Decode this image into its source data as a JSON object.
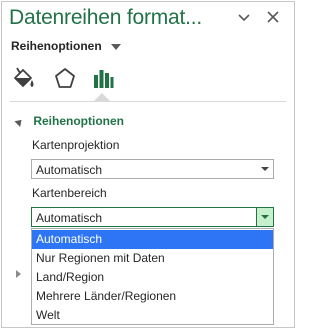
{
  "pane": {
    "title": "Datenreihen format...",
    "options_menu_label": "Reihenoptionen"
  },
  "tabs": [
    {
      "icon": "paint-bucket-icon"
    },
    {
      "icon": "pentagon-icon"
    },
    {
      "icon": "bar-chart-icon",
      "selected": true
    }
  ],
  "section": {
    "title": "Reihenoptionen",
    "projection": {
      "label": "Kartenprojektion",
      "value": "Automatisch"
    },
    "area": {
      "label": "Kartenbereich",
      "value": "Automatisch",
      "options": [
        "Automatisch",
        "Nur Regionen mit Daten",
        "Land/Region",
        "Mehrere Länder/Regionen",
        "Welt"
      ],
      "selected_index": 0
    }
  },
  "colors": {
    "accent": "#217346",
    "highlight": "#2e75f6"
  }
}
